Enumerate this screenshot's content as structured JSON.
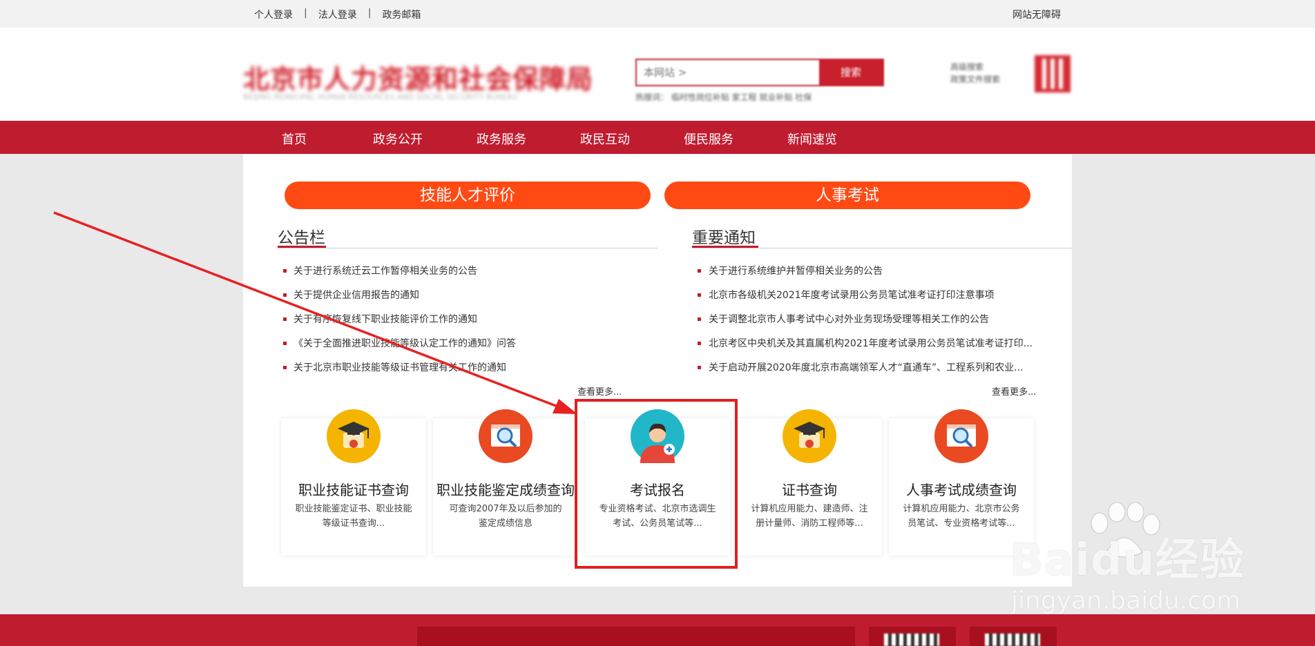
{
  "topbar": {
    "links": [
      "个人登录",
      "法人登录",
      "政务邮箱"
    ],
    "separator": "|",
    "accessibility": "网站无障碍"
  },
  "header": {
    "site_title": "北京市人力资源和社会保障局",
    "site_subtitle": "BEIJING MUNICIPAL HUMAN RESOURCES AND SOCIAL SECURITY BUREAU",
    "search_placeholder": "本网站 >",
    "search_button": "搜索",
    "hot_searches": "热搜词：  临时性岗位补贴  家工程  就业补贴  社保",
    "advanced_search": "高级搜索",
    "policy_search": "政策文件搜索"
  },
  "nav": {
    "items": [
      "首页",
      "政务公开",
      "政务服务",
      "政民互动",
      "便民服务",
      "新闻速览"
    ]
  },
  "main": {
    "left_banner": "技能人才评价",
    "right_banner": "人事考试",
    "left_section": {
      "title": "公告栏",
      "items": [
        "关于进行系统迁云工作暂停相关业务的公告",
        "关于提供企业信用报告的通知",
        "关于有序恢复线下职业技能评价工作的通知",
        "《关于全面推进职业技能等级认定工作的通知》问答",
        "关于北京市职业技能等级证书管理有关工作的通知"
      ],
      "more": "查看更多..."
    },
    "right_section": {
      "title": "重要通知",
      "items": [
        "关于进行系统维护并暂停相关业务的公告",
        "北京市各级机关2021年度考试录用公务员笔试准考证打印注意事项",
        "关于调整北京市人事考试中心对外业务现场受理等相关工作的公告",
        "北京考区中央机关及其直属机构2021年度考试录用公务员笔试准考证打印...",
        "关于启动开展2020年度北京市高端领军人才“直通车”、工程系列和农业..."
      ],
      "more": "查看更多..."
    },
    "cards": [
      {
        "title": "职业技能证书查询",
        "desc": "职业技能鉴定证书、职业技能等级证书查询...",
        "icon": "graduation-cap-icon"
      },
      {
        "title": "职业技能鉴定成绩查询",
        "desc": "可查询2007年及以后参加的鉴定成绩信息",
        "icon": "magnifier-icon"
      },
      {
        "title": "考试报名",
        "desc": "专业资格考试、北京市选调生考试、公务员笔试等...",
        "icon": "person-add-icon"
      },
      {
        "title": "证书查询",
        "desc": "计算机应用能力、建造师、注册计量师、消防工程师等...",
        "icon": "graduation-cap-icon"
      },
      {
        "title": "人事考试成绩查询",
        "desc": "计算机应用能力、北京市公务员笔试、专业资格考试等...",
        "icon": "magnifier-icon"
      }
    ]
  },
  "watermark": {
    "main": "Baidu经验",
    "sub": "jingyan.baidu.com"
  },
  "colors": {
    "brand_red": "#c01c30",
    "banner_orange": "#ff4a14",
    "highlight_red": "#e02020"
  }
}
